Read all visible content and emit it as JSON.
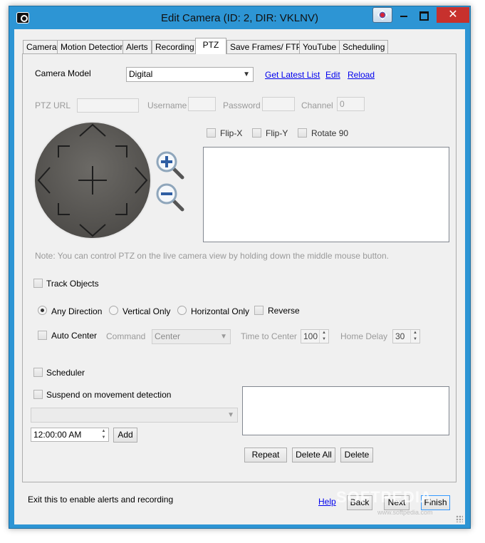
{
  "window": {
    "title": "Edit Camera (ID: 2, DIR: VKLNV)",
    "close_glyph": "✕"
  },
  "tabs": [
    {
      "label": "Camera"
    },
    {
      "label": "Motion Detection"
    },
    {
      "label": "Alerts"
    },
    {
      "label": "Recording"
    },
    {
      "label": "PTZ",
      "active": true
    },
    {
      "label": "Save Frames/ FTP"
    },
    {
      "label": "YouTube"
    },
    {
      "label": "Scheduling"
    }
  ],
  "ptz": {
    "camera_model_label": "Camera Model",
    "camera_model_value": "Digital",
    "get_latest_list": "Get Latest List",
    "edit": "Edit",
    "reload": "Reload",
    "ptz_url_label": "PTZ URL",
    "ptz_url_value": "",
    "username_label": "Username",
    "username_value": "",
    "password_label": "Password",
    "password_value": "",
    "channel_label": "Channel",
    "channel_value": "0",
    "flip_x": "Flip-X",
    "flip_y": "Flip-Y",
    "rotate_90": "Rotate 90",
    "note": "Note: You can control PTZ on the live camera view by holding down the middle mouse button.",
    "track_objects": "Track Objects",
    "any_direction": "Any Direction",
    "vertical_only": "Vertical Only",
    "horizontal_only": "Horizontal Only",
    "reverse": "Reverse",
    "auto_center": "Auto Center",
    "command_label": "Command",
    "command_value": "Center",
    "time_to_center_label": "Time to Center",
    "time_to_center_value": "100",
    "home_delay_label": "Home Delay",
    "home_delay_value": "30",
    "scheduler": "Scheduler",
    "suspend_on_movement": "Suspend on movement detection",
    "schedule_select_value": "",
    "time_value": "12:00:00 AM",
    "add": "Add",
    "repeat": "Repeat",
    "delete_all": "Delete All",
    "delete": "Delete"
  },
  "footer": {
    "status_text": "Exit this to enable alerts and recording",
    "help": "Help",
    "back": "Back",
    "next": "Next",
    "finish": "Finish"
  },
  "watermark": {
    "text": "SOFTPEDIA",
    "sub": "www.softpedia.com"
  },
  "colors": {
    "titlebar": "#2d95d4",
    "close_button": "#c7312d",
    "link": "#0000ee",
    "dial": "#5f5d59"
  }
}
